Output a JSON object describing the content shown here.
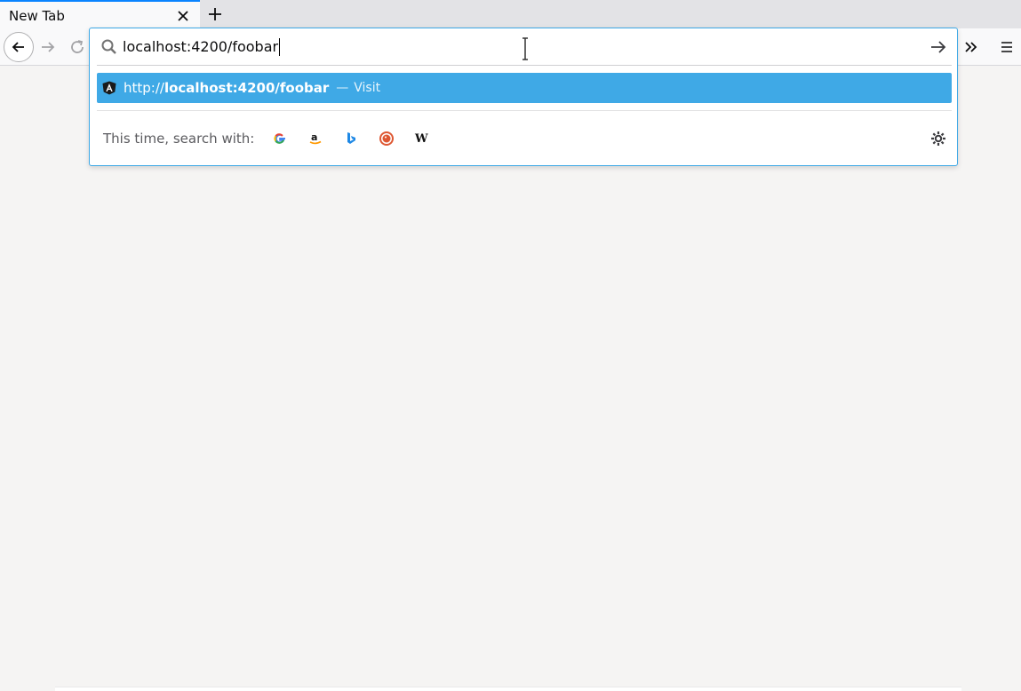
{
  "tab": {
    "title": "New Tab",
    "close_icon": "close-icon"
  },
  "toolbar": {
    "new_tab_icon": "plus-icon",
    "back_icon": "arrow-left-icon",
    "forward_icon": "arrow-right-icon",
    "reload_icon": "reload-icon",
    "overflow_icon": "chevron-double-right-icon",
    "menu_icon": "hamburger-menu-icon"
  },
  "urlbar": {
    "value": "localhost:4200/foobar",
    "search_icon": "search-icon",
    "go_icon": "arrow-right-icon"
  },
  "result": {
    "url_prefix": "http://",
    "url_host": "localhost:4200/foobar",
    "separator": "—",
    "action": "Visit",
    "icon": "angular-icon",
    "highlight_color": "#3fa9e6"
  },
  "one_off": {
    "label": "This time, search with:",
    "engines": [
      {
        "name": "google-icon",
        "glyph": "G",
        "color": "#4285f4"
      },
      {
        "name": "amazon-icon",
        "glyph": "a",
        "color": "#000000"
      },
      {
        "name": "bing-icon",
        "glyph": "b",
        "color": "#2196f3"
      },
      {
        "name": "duckduckgo-icon",
        "glyph": "D",
        "color": "#de5833"
      },
      {
        "name": "wikipedia-icon",
        "glyph": "W",
        "color": "#000000"
      }
    ],
    "settings_icon": "gear-icon"
  }
}
